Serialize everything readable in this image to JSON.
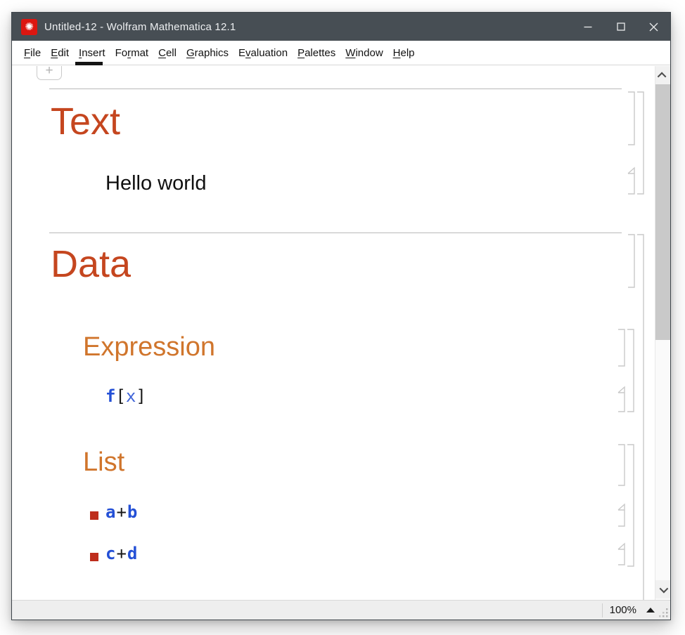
{
  "title_bar": {
    "title": "Untitled-12 - Wolfram Mathematica 12.1"
  },
  "menu_bar": {
    "items": [
      {
        "label": "File",
        "mnemonic_index": 0
      },
      {
        "label": "Edit",
        "mnemonic_index": 0
      },
      {
        "label": "Insert",
        "mnemonic_index": 0
      },
      {
        "label": "Format",
        "mnemonic_index": 2
      },
      {
        "label": "Cell",
        "mnemonic_index": 0
      },
      {
        "label": "Graphics",
        "mnemonic_index": 0
      },
      {
        "label": "Evaluation",
        "mnemonic_index": 1
      },
      {
        "label": "Palettes",
        "mnemonic_index": 0
      },
      {
        "label": "Window",
        "mnemonic_index": 0
      },
      {
        "label": "Help",
        "mnemonic_index": 0
      }
    ]
  },
  "notebook": {
    "plus_button": "+",
    "section_text_title": "Text",
    "text_cell": "Hello world",
    "section_data_title": "Data",
    "subsection_expression_title": "Expression",
    "expression_code": {
      "head": "f",
      "open": "[",
      "arg": "x",
      "close": "]"
    },
    "subsection_list_title": "List",
    "item1": {
      "lhs": "a",
      "op": "+",
      "rhs": "b"
    },
    "item2": {
      "lhs": "c",
      "op": "+",
      "rhs": "d"
    }
  },
  "status_bar": {
    "zoom_level": "100%"
  },
  "colors": {
    "titlebar": "#474e54",
    "icon_red": "#dc1610",
    "section": "#c5461f",
    "subsection": "#d0752c",
    "code_blue": "#2450d6",
    "code_blue_light": "#4165d9",
    "bullet_red": "#be2d1c"
  }
}
